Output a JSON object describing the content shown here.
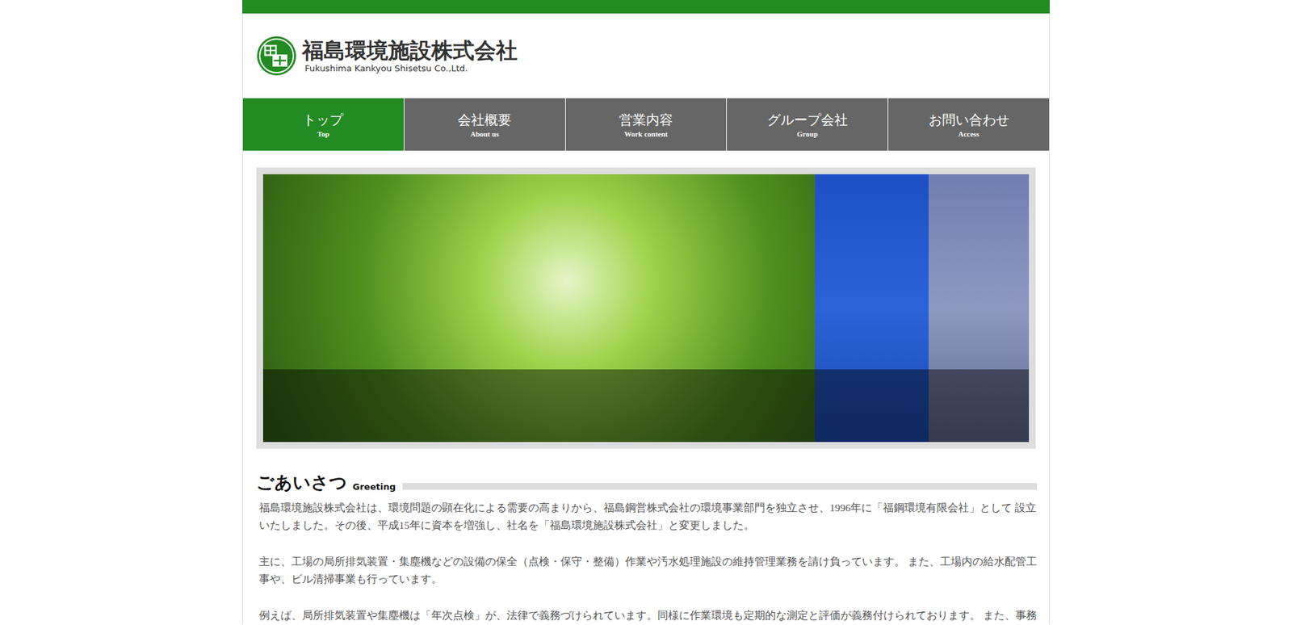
{
  "header": {
    "company_name": "福島環境施設株式会社",
    "company_name_en": "Fukushima Kankyou Shisetsu Co.,Ltd."
  },
  "nav": [
    {
      "label": "トップ",
      "sub": "Top",
      "selected": true
    },
    {
      "label": "会社概要",
      "sub": "About us",
      "selected": false
    },
    {
      "label": "営業内容",
      "sub": "Work content",
      "selected": false
    },
    {
      "label": "グループ会社",
      "sub": "Group",
      "selected": false
    },
    {
      "label": "お問い合わせ",
      "sub": "Access",
      "selected": false
    }
  ],
  "section": {
    "title": "ごあいさつ",
    "subtitle": "Greeting"
  },
  "paragraphs": [
    "福島環境施設株式会社は、環境問題の顕在化による需要の高まりから、福島鋼営株式会社の環境事業部門を独立させ、1996年に「福鋼環境有限会社」として 設立いたしました。その後、平成15年に資本を増強し、社名を「福島環境施設株式会社」と変更しました。",
    "主に、工場の局所排気装置・集塵機などの設備の保全（点検・保守・整備）作業や汚水処理施設の維持管理業務を請け負っています。 また、工場内の給水配管工事や、ビル清掃事業も行っています。",
    "例えば、局所排気装置や集塵機は「年次点検」が、法律で義務づけられています。同様に作業環境も定期的な測定と評価が義務付けられております。 また、事務"
  ]
}
